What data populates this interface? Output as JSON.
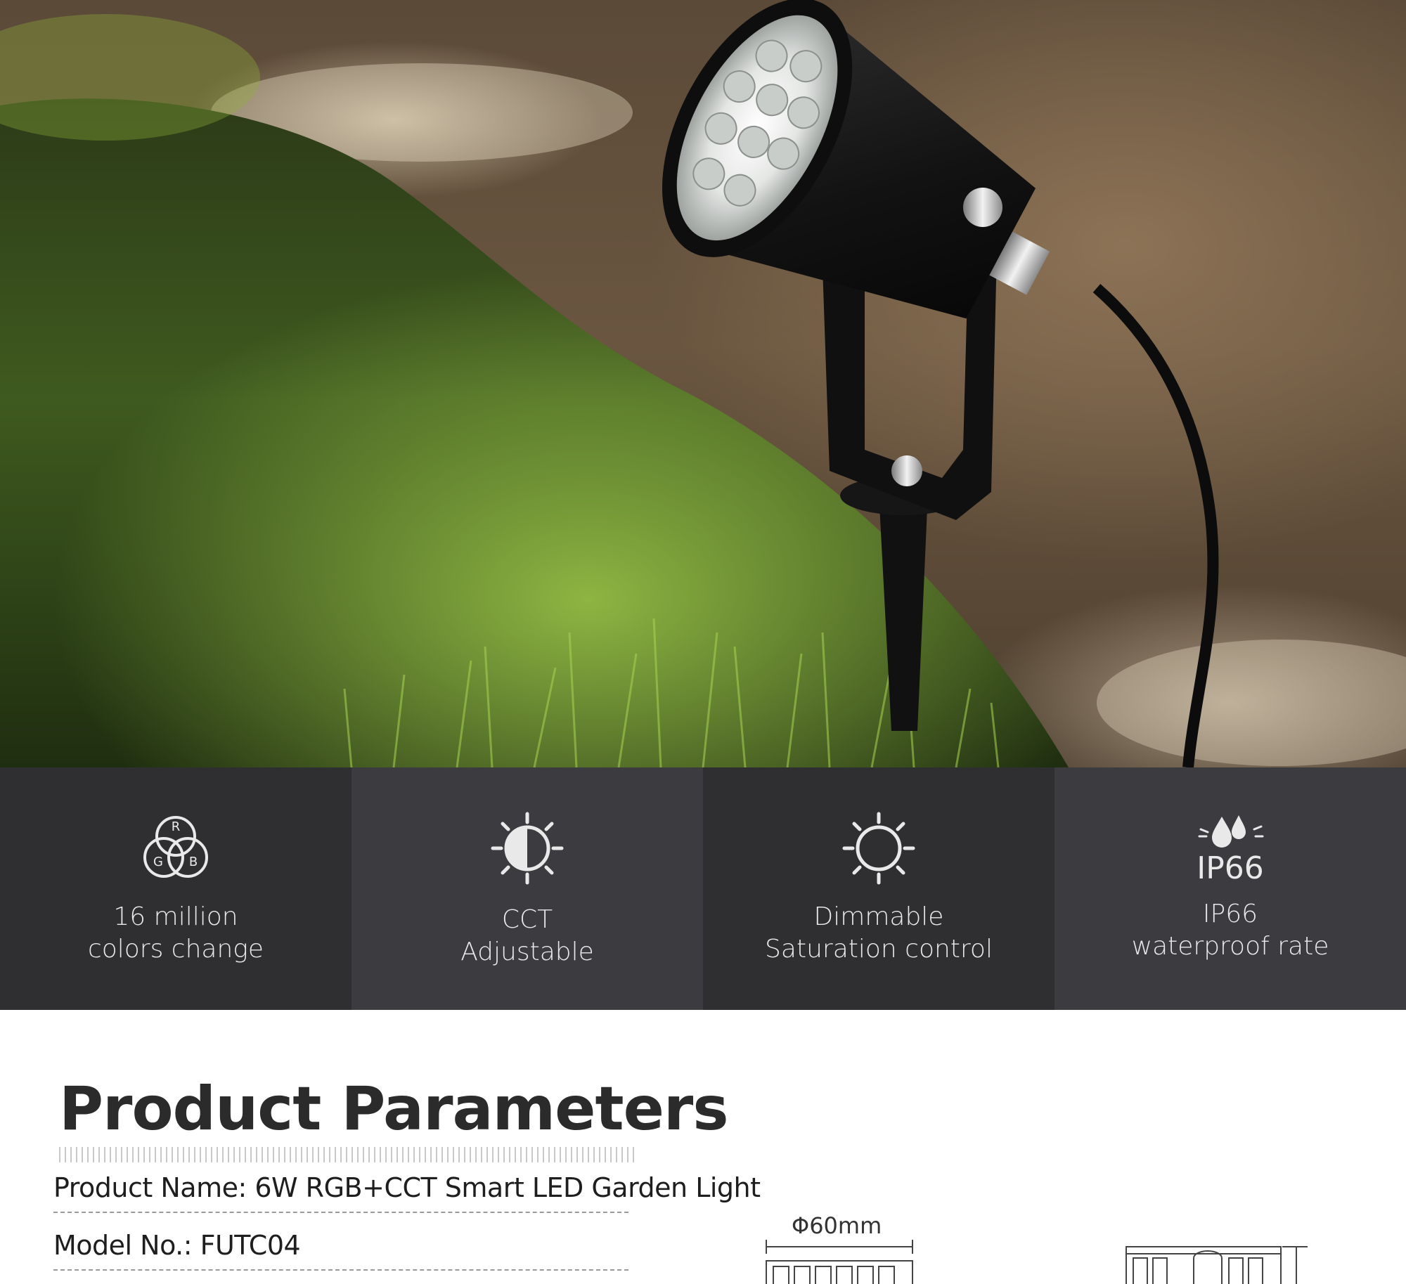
{
  "hero": {
    "scene": "garden-spotlight-on-lawn"
  },
  "features": [
    {
      "icon": "rgb-circles-icon",
      "line1": "16 million",
      "line2": "colors change"
    },
    {
      "icon": "cct-half-sun-icon",
      "line1": "CCT",
      "line2": "Adjustable"
    },
    {
      "icon": "sun-outline-icon",
      "line1": "Dimmable",
      "line2": "Saturation control"
    },
    {
      "icon": "water-drops-icon",
      "icon_text": "IP66",
      "line1": "IP66",
      "line2": "waterproof rate"
    }
  ],
  "rgb_letters": {
    "r": "R",
    "g": "G",
    "b": "B"
  },
  "parameters": {
    "title": "Product Parameters",
    "rows": [
      {
        "text": "Product Name: 6W RGB+CCT Smart LED Garden Light"
      },
      {
        "text": "Model No.: FUTC04"
      }
    ],
    "dimension_label": "Φ60mm"
  },
  "colors": {
    "band_dark": "#2f2f31",
    "band_light": "#3c3b3f",
    "band_text": "#e9e9ea",
    "title": "#2b2b2b"
  }
}
